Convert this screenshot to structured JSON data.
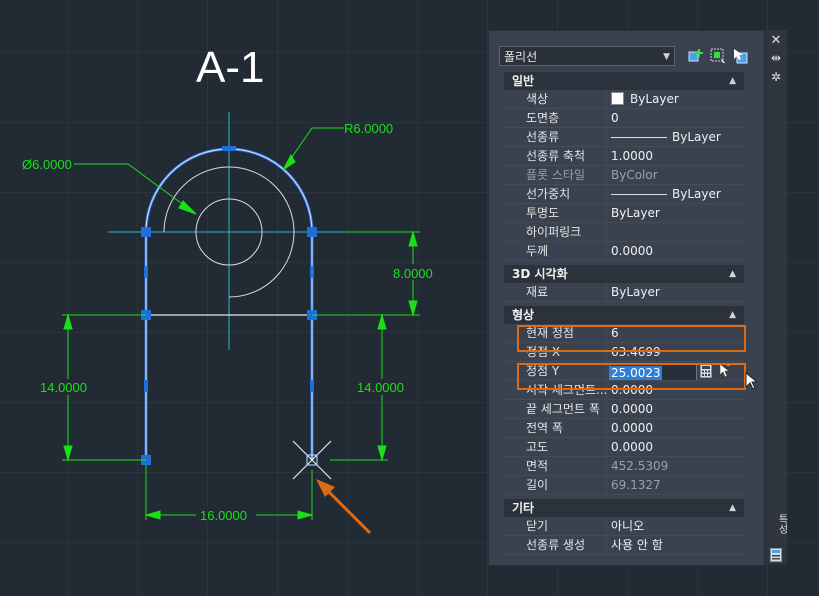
{
  "drawing": {
    "title": "A-1",
    "dims": {
      "radius": "R6.0000",
      "diameter": "Ø6.0000",
      "height_right_top": "8.0000",
      "height_left": "14.0000",
      "height_right": "14.0000",
      "width_bottom": "16.0000"
    },
    "colors": {
      "dimension": "#19e019",
      "selection": "#9fc8ff",
      "grip": "#1e6fd9",
      "centerline": "#29b8c8",
      "annotation_arrow": "#e06a10"
    }
  },
  "palette": {
    "object_type": "폴리선",
    "toolbar_icons": [
      "quick-select-icon",
      "select-objects-icon",
      "toggle-pickadd-icon"
    ],
    "side_icons": [
      "close-icon",
      "autohide-icon",
      "settings-icon"
    ],
    "side_label": "특성",
    "categories": {
      "general": {
        "label": "일반",
        "rows": [
          {
            "name": "색상",
            "value": "ByLayer"
          },
          {
            "name": "도면층",
            "value": "0"
          },
          {
            "name": "선종류",
            "value": "ByLayer"
          },
          {
            "name": "선종류 축척",
            "value": "1.0000"
          },
          {
            "name": "플롯 스타일",
            "value": "ByColor"
          },
          {
            "name": "선가중치",
            "value": "ByLayer"
          },
          {
            "name": "투명도",
            "value": "ByLayer"
          },
          {
            "name": "하이퍼링크",
            "value": ""
          },
          {
            "name": "두께",
            "value": "0.0000"
          }
        ]
      },
      "viz3d": {
        "label": "3D 시각화",
        "rows": [
          {
            "name": "재료",
            "value": "ByLayer"
          }
        ]
      },
      "geometry": {
        "label": "형상",
        "rows": [
          {
            "name": "현재 정점",
            "value": "6"
          },
          {
            "name": "정점 X",
            "value": "63.4699"
          },
          {
            "name": "정점 Y",
            "value": "25.0023"
          },
          {
            "name": "시작 세그먼트...",
            "value": "0.0000"
          },
          {
            "name": "끝 세그먼트 폭",
            "value": "0.0000"
          },
          {
            "name": "전역 폭",
            "value": "0.0000"
          },
          {
            "name": "고도",
            "value": "0.0000"
          },
          {
            "name": "면적",
            "value": "452.5309"
          },
          {
            "name": "길이",
            "value": "69.1327"
          }
        ]
      },
      "misc": {
        "label": "기타",
        "rows": [
          {
            "name": "닫기",
            "value": "아니오"
          },
          {
            "name": "선종류 생성",
            "value": "사용 안 함"
          }
        ]
      }
    }
  }
}
